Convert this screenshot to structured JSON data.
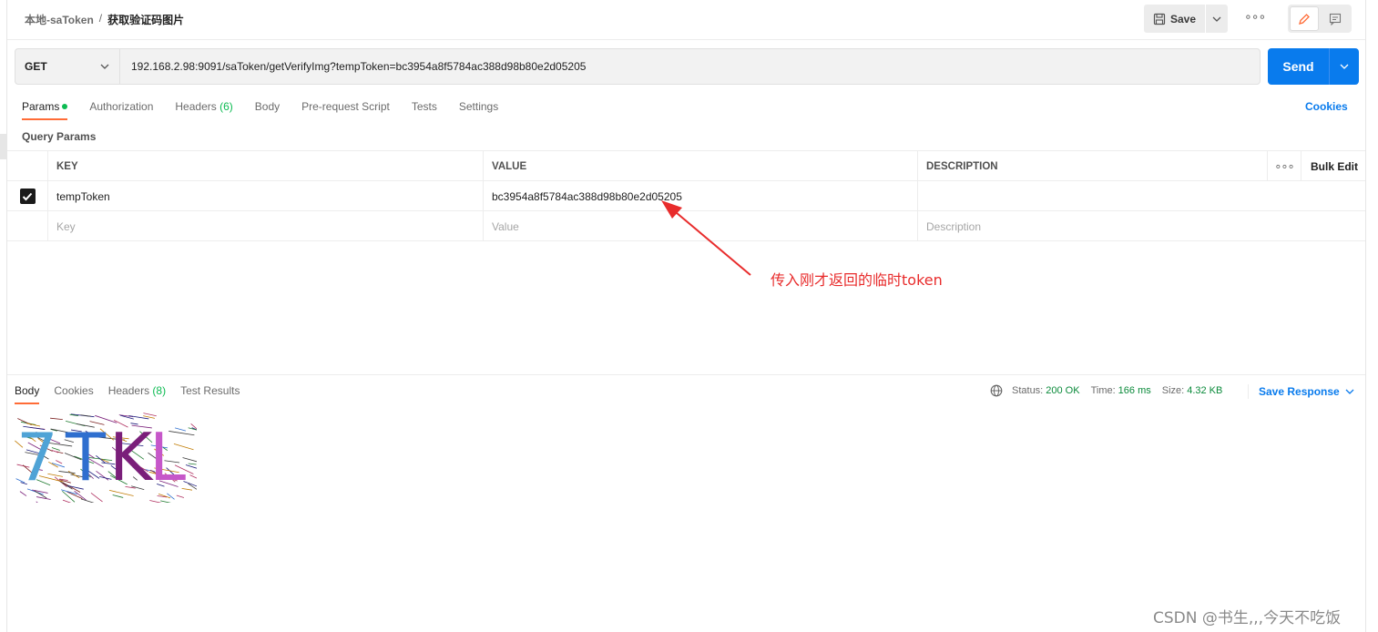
{
  "header": {
    "collection": "本地-saToken",
    "separator": "/",
    "request_name": "获取验证码图片",
    "save_label": "Save"
  },
  "request": {
    "method": "GET",
    "url": "192.168.2.98:9091/saToken/getVerifyImg?tempToken=bc3954a8f5784ac388d98b80e2d05205",
    "send_label": "Send"
  },
  "req_tabs": {
    "params": "Params",
    "authorization": "Authorization",
    "headers": "Headers",
    "headers_count": "(6)",
    "body": "Body",
    "prerequest": "Pre-request Script",
    "tests": "Tests",
    "settings": "Settings",
    "cookies": "Cookies"
  },
  "query_params": {
    "title": "Query Params",
    "col_key": "KEY",
    "col_value": "VALUE",
    "col_description": "DESCRIPTION",
    "bulk_edit": "Bulk Edit",
    "rows": [
      {
        "key": "tempToken",
        "value": "bc3954a8f5784ac388d98b80e2d05205",
        "description": "",
        "checked": true
      }
    ],
    "placeholder_key": "Key",
    "placeholder_value": "Value",
    "placeholder_description": "Description"
  },
  "annotation": {
    "text": "传入刚才返回的临时token",
    "color": "#e82c2c"
  },
  "response": {
    "tabs": {
      "body": "Body",
      "cookies": "Cookies",
      "headers": "Headers",
      "headers_count": "(8)",
      "test_results": "Test Results"
    },
    "status_label": "Status:",
    "status_value": "200 OK",
    "time_label": "Time:",
    "time_value": "166 ms",
    "size_label": "Size:",
    "size_value": "4.32 KB",
    "save_response": "Save Response",
    "captcha_chars": [
      {
        "char": "7",
        "color": "#4fa3d6"
      },
      {
        "char": "T",
        "color": "#2f6fcf"
      },
      {
        "char": "K",
        "color": "#7a1f7a"
      },
      {
        "char": "L",
        "color": "#c657c9"
      }
    ]
  },
  "watermark": "CSDN @书生,,,今天不吃饭",
  "colors": {
    "accent_orange": "#ff6c37",
    "send_blue": "#097bed",
    "status_green": "#0a8a3a"
  }
}
